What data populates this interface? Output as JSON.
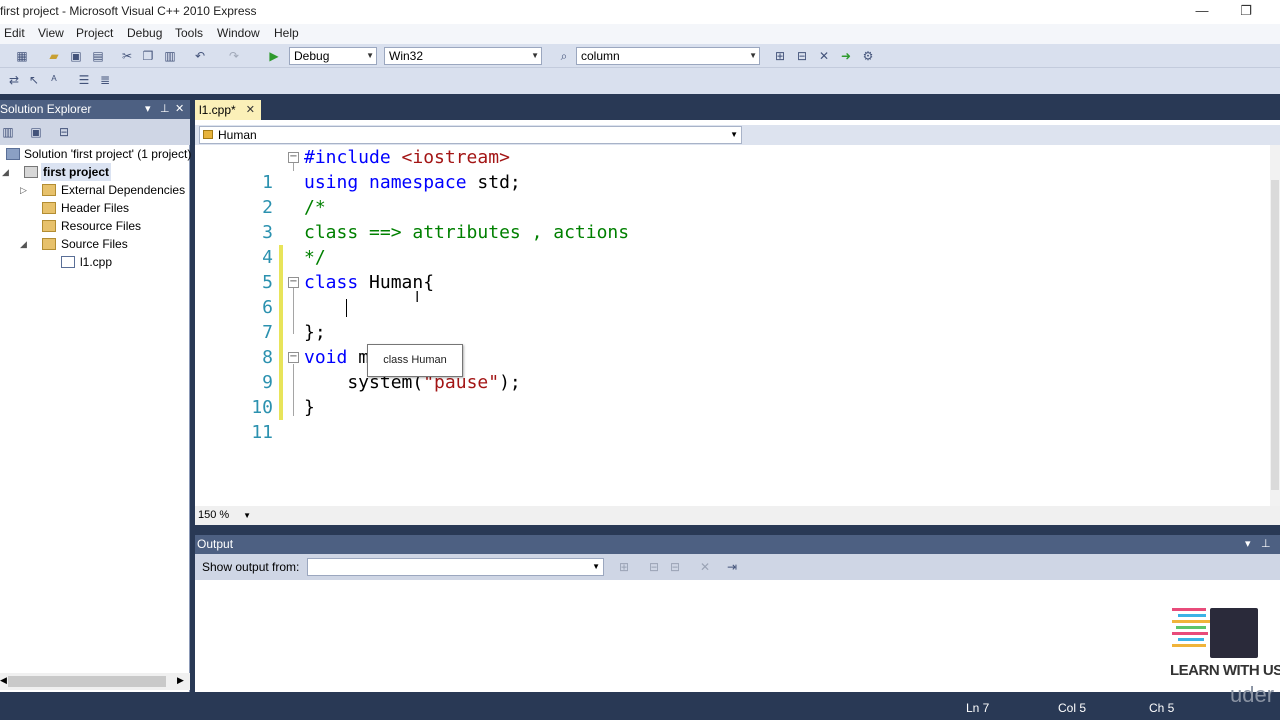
{
  "window": {
    "title": "first project - Microsoft Visual C++ 2010 Express"
  },
  "menu": [
    "Edit",
    "View",
    "Project",
    "Debug",
    "Tools",
    "Window",
    "Help"
  ],
  "toolbar": {
    "config": "Debug",
    "platform": "Win32",
    "find": "column"
  },
  "solution_explorer": {
    "title": "Solution Explorer",
    "items": [
      {
        "label": "Solution 'first project' (1 project)",
        "icon": "solution-icon"
      },
      {
        "label": "first project",
        "icon": "project-icon",
        "bold": true
      },
      {
        "label": "External Dependencies",
        "icon": "folder-icon"
      },
      {
        "label": "Header Files",
        "icon": "folder-icon"
      },
      {
        "label": "Resource Files",
        "icon": "folder-icon"
      },
      {
        "label": "Source Files",
        "icon": "folder-icon"
      },
      {
        "label": "l1.cpp",
        "icon": "cpp-file-icon"
      }
    ]
  },
  "editor": {
    "tab": "l1.cpp*",
    "nav_class": "Human",
    "zoom": "150 %",
    "tooltip": "class Human",
    "lines": [
      "1",
      "2",
      "3",
      "4",
      "5",
      "6",
      "7",
      "8",
      "9",
      "10",
      "11"
    ],
    "code": {
      "l1": {
        "a": "#include",
        "b": " <iostream>"
      },
      "l2": {
        "a": "using",
        "b": " ",
        "c": "namespace",
        "d": " std;"
      },
      "l3": "/*",
      "l4": "class ==> attributes , actions",
      "l5": "*/",
      "l6": {
        "a": "class",
        "b": " Human{"
      },
      "l8": "};",
      "l9": {
        "a": "void",
        "b": " main (){"
      },
      "l10": {
        "a": "    system(",
        "b": "\"pause\"",
        "c": ");"
      },
      "l11": "}"
    }
  },
  "output": {
    "title": "Output",
    "show_from": "Show output from:"
  },
  "status": {
    "ln": "Ln 7",
    "col": "Col 5",
    "ch": "Ch 5"
  },
  "logo": {
    "text": "LEARN WITH US",
    "watermark": "uder"
  }
}
